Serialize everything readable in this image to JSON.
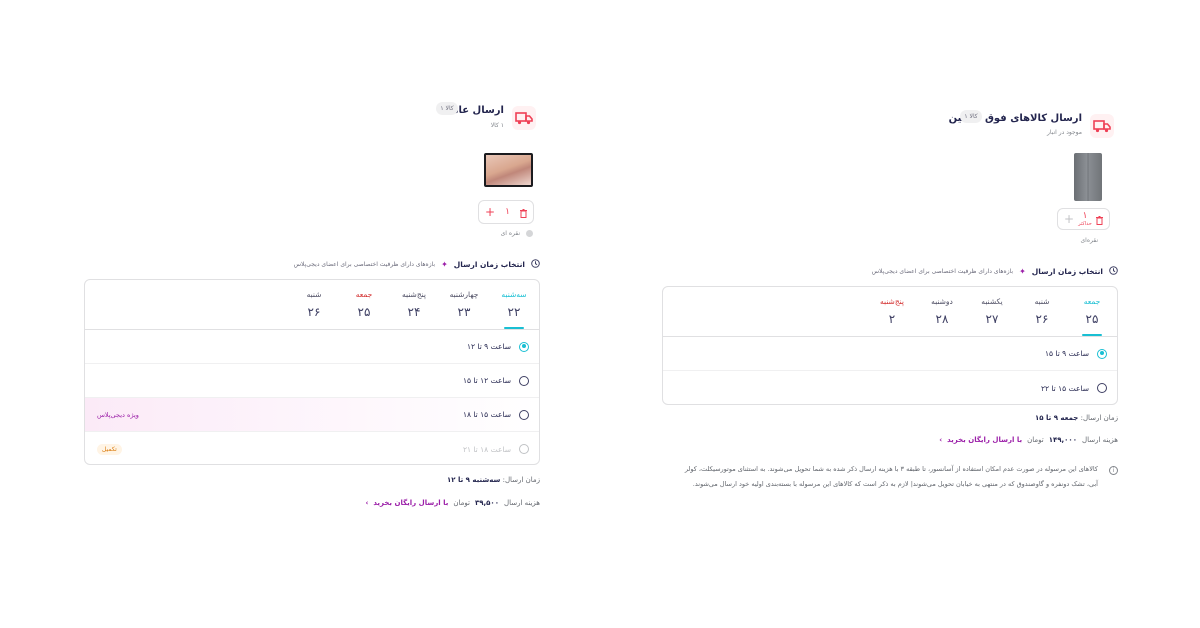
{
  "left": {
    "shipment": {
      "title": "ارسال عادی",
      "count": "۱ کالا",
      "pill": "کالا ۱"
    },
    "product": {
      "quantity": "۱",
      "note": "نقره ای"
    },
    "section": {
      "title": "انتخاب زمان ارسال",
      "extra": "بازه‌های دارای ظرفیت اختصاصی برای اعضای دیجی‌پلاس"
    },
    "days": [
      {
        "name": "سه‌شنبه",
        "num": "۲۲",
        "active": true
      },
      {
        "name": "چهارشنبه",
        "num": "۲۳"
      },
      {
        "name": "پنج‌شنبه",
        "num": "۲۴"
      },
      {
        "name": "جمعه",
        "num": "۲۵",
        "red": true
      },
      {
        "name": "شنبه",
        "num": "۲۶"
      }
    ],
    "slots": [
      {
        "text": "ساعت ۹ تا ۱۲",
        "selected": true
      },
      {
        "text": "ساعت ۱۲ تا ۱۵"
      },
      {
        "text": "ساعت ۱۵ تا ۱۸",
        "special": "ویژه دیجی‌پلاس"
      },
      {
        "text": "ساعت ۱۸ تا ۲۱",
        "disabled": true,
        "full": "تکمیل"
      }
    ],
    "summary": {
      "label": "زمان ارسال:",
      "value": "سه‌شنبه ۹ تا ۱۲"
    },
    "cost": {
      "label": "هزینه ارسال",
      "value": "۳۹,۵۰۰",
      "currency": "تومان",
      "free": "با ارسال رایگان بخرید"
    }
  },
  "right": {
    "shipment": {
      "title": "ارسال کالاهای فوق سنگین",
      "count": "موجود در انبار",
      "pill": "کالا ۱"
    },
    "product": {
      "quantity": "۱",
      "max": "حداکثر",
      "note": "نقره‌ای"
    },
    "section": {
      "title": "انتخاب زمان ارسال",
      "extra": "بازه‌های دارای ظرفیت اختصاصی برای اعضای دیجی‌پلاس"
    },
    "days": [
      {
        "name": "جمعه",
        "num": "۲۵",
        "active": true,
        "red": true
      },
      {
        "name": "شنبه",
        "num": "۲۶"
      },
      {
        "name": "یکشنبه",
        "num": "۲۷"
      },
      {
        "name": "دوشنبه",
        "num": "۲۸"
      },
      {
        "name": "پنج‌شنبه",
        "num": "۲",
        "red": true
      }
    ],
    "slots": [
      {
        "text": "ساعت ۹ تا ۱۵",
        "selected": true
      },
      {
        "text": "ساعت ۱۵ تا ۲۲"
      }
    ],
    "summary": {
      "label": "زمان ارسال:",
      "value": "جمعه ۹ تا ۱۵"
    },
    "cost": {
      "label": "هزینه ارسال",
      "value": "۱۴۹,۰۰۰",
      "currency": "تومان",
      "free": "با ارسال رایگان بخرید"
    },
    "info": "کالاهای این مرسوله در صورت عدم امکان استفاده از آسانسور، تا طبقه ۳ با هزینه ارسال ذکر شده به شما تحویل می‌شوند. به استثنای موتورسیکلت، کولر آبی، تشک دونفره و گاوصندوق که در منتهی به خیابان تحویل می‌شوند| لازم به ذکر است که کالاهای این مرسوله با بسته‌بندی اولیه خود ارسال می‌شوند."
  },
  "colors": {
    "accent": "#19bfd3",
    "brand": "#ef4056",
    "plus": "#9b1fa8",
    "text": "#23254e"
  }
}
